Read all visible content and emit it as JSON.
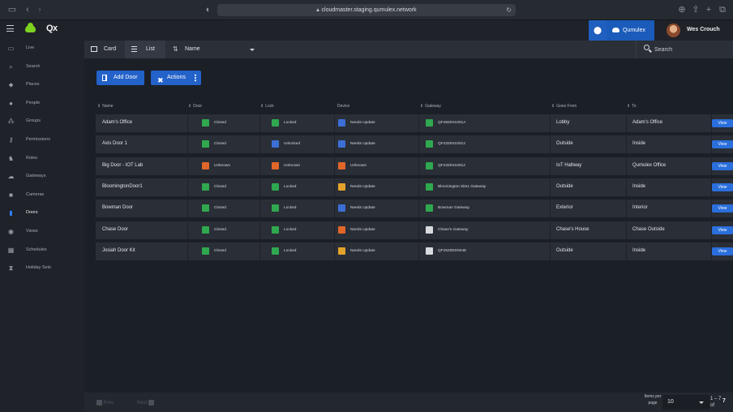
{
  "browser": {
    "url": "cloudmaster.staging.qumulex.network"
  },
  "app": {
    "logo_text": "Qx",
    "org_name": "Qumulex",
    "user_name": "Wes Crouch",
    "accent_color": "#2362c9",
    "brand_color": "#7ed321"
  },
  "sidebar": {
    "items": [
      {
        "label": "Live",
        "icon": "monitor-icon"
      },
      {
        "label": "Search",
        "icon": "search-icon"
      },
      {
        "label": "Places",
        "icon": "map-pin-icon"
      },
      {
        "label": "People",
        "icon": "person-icon"
      },
      {
        "label": "Groups",
        "icon": "users-icon"
      },
      {
        "label": "Permissions",
        "icon": "key-icon"
      },
      {
        "label": "Roles",
        "icon": "roles-icon"
      },
      {
        "label": "Gateways",
        "icon": "cloud-icon"
      },
      {
        "label": "Cameras",
        "icon": "camera-icon"
      },
      {
        "label": "Doors",
        "icon": "door-icon",
        "active": true
      },
      {
        "label": "Views",
        "icon": "eye-icon"
      },
      {
        "label": "Schedules",
        "icon": "calendar-icon"
      },
      {
        "label": "Holiday Sets",
        "icon": "hourglass-icon"
      }
    ]
  },
  "viewbar": {
    "card_label": "Card",
    "list_label": "List",
    "sort_value": "Name",
    "search_placeholder": "Search"
  },
  "actions": {
    "add_door": "Add Door",
    "actions": "Actions"
  },
  "table": {
    "headers": {
      "name": "Name",
      "door": "Door",
      "lock": "Lock",
      "device": "Device",
      "gateway": "Gateway",
      "goes_from": "Goes From",
      "to": "To"
    },
    "view_label": "View",
    "rows": [
      {
        "name": "Adam's Office",
        "door": "Closed",
        "lock": "Locked",
        "device": "Needs Update",
        "gateway": "QF4820S1001A",
        "goes_from": "Lobby",
        "to": "Adam's Office",
        "door_state": "ok",
        "lock_state": "ok",
        "device_state": "info",
        "gateway_state": "ok"
      },
      {
        "name": "Axis Door 1",
        "door": "Closed",
        "lock": "Unlocked",
        "device": "Needs Update",
        "gateway": "QF4320S10012",
        "goes_from": "Outside",
        "to": "Inside",
        "door_state": "ok",
        "lock_state": "info",
        "device_state": "info",
        "gateway_state": "ok"
      },
      {
        "name": "Big Door - IOT Lab",
        "door": "Unknown",
        "lock": "Unknown",
        "device": "Unknown",
        "gateway": "QF4320S10012",
        "goes_from": "IoT Hallway",
        "to": "Qumulex Office",
        "door_state": "warn",
        "lock_state": "warn",
        "device_state": "warn",
        "gateway_state": "ok"
      },
      {
        "name": "BloomingtonDoor1",
        "door": "Closed",
        "lock": "Locked",
        "device": "Needs Update",
        "gateway": "Bloomington Site1 Gateway",
        "goes_from": "Outside",
        "to": "Inside",
        "door_state": "ok",
        "lock_state": "ok",
        "device_state": "alert",
        "gateway_state": "ok"
      },
      {
        "name": "Bowman Door",
        "door": "Closed",
        "lock": "Locked",
        "device": "Needs Update",
        "gateway": "Bowman Gateway",
        "goes_from": "Exterior",
        "to": "Interior",
        "door_state": "ok",
        "lock_state": "ok",
        "device_state": "info",
        "gateway_state": "ok"
      },
      {
        "name": "Chase Door",
        "door": "Closed",
        "lock": "Locked",
        "device": "Needs Update",
        "gateway": "Chase's Gateway",
        "goes_from": "Chase's House",
        "to": "Chase Outside",
        "door_state": "ok",
        "lock_state": "ok",
        "device_state": "warn",
        "gateway_state": "neutral"
      },
      {
        "name": "Josiah Door Kit",
        "door": "Closed",
        "lock": "Locked",
        "device": "Needs Update",
        "gateway": "QF2520ED004E",
        "goes_from": "Outside",
        "to": "Inside",
        "door_state": "ok",
        "lock_state": "ok",
        "device_state": "alert",
        "gateway_state": "neutral"
      }
    ]
  },
  "status_colors": {
    "ok": "#2fa84f",
    "info": "#3b6fd6",
    "warn": "#e0662a",
    "alert": "#e3a32b",
    "neutral": "#d9dbdf"
  },
  "footer": {
    "prev": "Prev",
    "next": "Next",
    "items_per_page_label": "Items per page",
    "items_per_page": "10",
    "range": "1 – 7 of",
    "total": "7"
  }
}
